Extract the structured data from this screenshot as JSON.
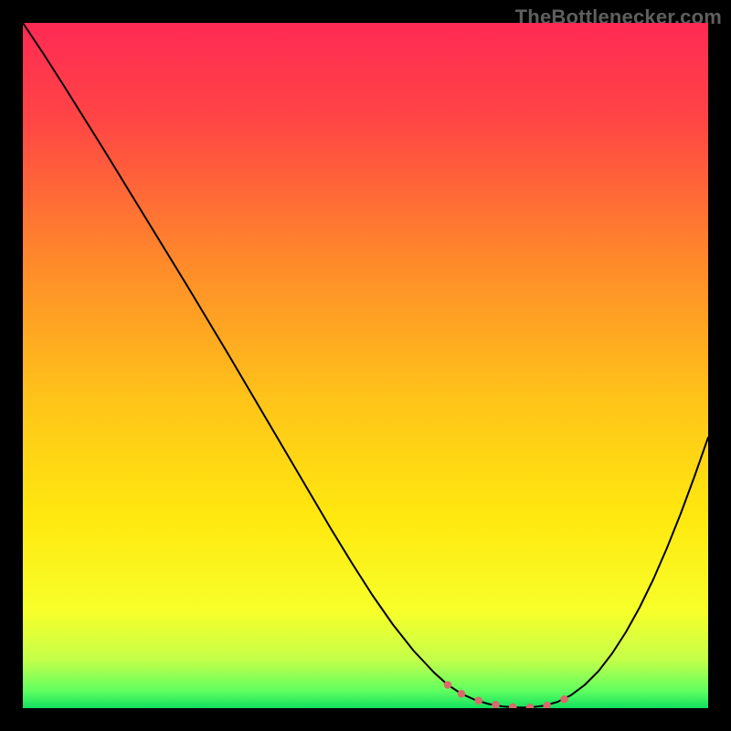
{
  "watermark": "TheBottlenecker.com",
  "chart_data": {
    "type": "line",
    "title": "",
    "xlabel": "",
    "ylabel": "",
    "xlim": [
      0,
      100
    ],
    "ylim": [
      0,
      100
    ],
    "gradient_stops": [
      {
        "offset": 0.0,
        "color": "#ff2a55"
      },
      {
        "offset": 0.14,
        "color": "#ff4545"
      },
      {
        "offset": 0.35,
        "color": "#ff8a2a"
      },
      {
        "offset": 0.55,
        "color": "#ffc419"
      },
      {
        "offset": 0.72,
        "color": "#ffe80f"
      },
      {
        "offset": 0.86,
        "color": "#f7ff2a"
      },
      {
        "offset": 0.93,
        "color": "#c3ff4a"
      },
      {
        "offset": 0.975,
        "color": "#60ff60"
      },
      {
        "offset": 1.0,
        "color": "#10e060"
      }
    ],
    "series": [
      {
        "name": "bottleneck-curve",
        "color": "#000000",
        "width": 2.0,
        "x": [
          0,
          3,
          6,
          9,
          12,
          15,
          18,
          21,
          24,
          27,
          30,
          33,
          36,
          39,
          42,
          45,
          48,
          51,
          54,
          57,
          60,
          62,
          64,
          66,
          68,
          70,
          72,
          74,
          76,
          78,
          80,
          82,
          84,
          86,
          88,
          90,
          92,
          94,
          96,
          98,
          100
        ],
        "y": [
          100,
          95.5,
          90.8,
          86,
          81.2,
          76.3,
          71.4,
          66.5,
          61.6,
          56.6,
          51.6,
          46.5,
          41.4,
          36.3,
          31.2,
          26.1,
          21.2,
          16.5,
          12.2,
          8.4,
          5.2,
          3.4,
          2.1,
          1.2,
          0.6,
          0.25,
          0.1,
          0.1,
          0.35,
          0.9,
          1.9,
          3.4,
          5.4,
          8.0,
          11.1,
          14.7,
          18.8,
          23.4,
          28.4,
          33.8,
          39.5
        ]
      }
    ],
    "markers": {
      "name": "highlight-range",
      "color": "#d86a6a",
      "radius": 4.3,
      "x": [
        62,
        64,
        66.5,
        69,
        71.5,
        74,
        76.5,
        79
      ],
      "y": [
        3.4,
        2.1,
        1.1,
        0.5,
        0.15,
        0.1,
        0.4,
        1.3
      ]
    }
  }
}
